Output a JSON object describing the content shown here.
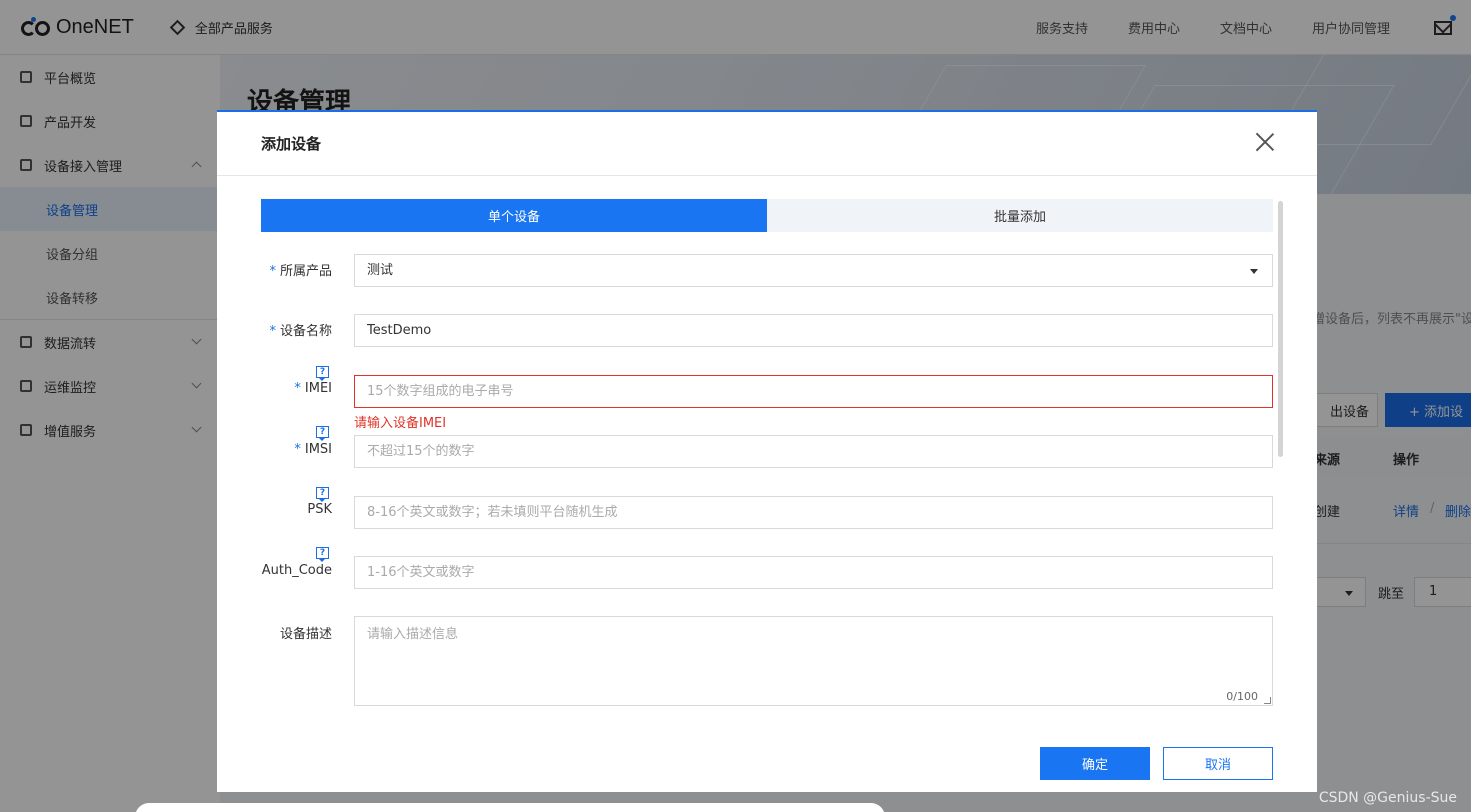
{
  "app": {
    "logo_text": "OneNET",
    "all_products": "全部产品服务",
    "top_nav": [
      "服务支持",
      "费用中心",
      "文档中心",
      "用户协同管理"
    ]
  },
  "sidebar": {
    "items": [
      {
        "label": "平台概览"
      },
      {
        "label": "产品开发"
      },
      {
        "label": "设备接入管理"
      },
      {
        "label": "设备管理"
      },
      {
        "label": "设备分组"
      },
      {
        "label": "设备转移"
      },
      {
        "label": "数据流转"
      },
      {
        "label": "运维监控"
      },
      {
        "label": "增值服务"
      }
    ]
  },
  "background": {
    "page_title": "设备管理",
    "note": "增设备后，列表不再展示\"设",
    "export_button": "出设备",
    "add_button": "+ 添加设",
    "table_headers": [
      "来源",
      "操作"
    ],
    "row": {
      "source": "创建",
      "detail": "详情",
      "sep": "/",
      "delete": "删除"
    },
    "pager_jump_label": "跳至",
    "pager_jump_value": "1"
  },
  "modal": {
    "title": "添加设备",
    "tabs": [
      {
        "label": "单个设备",
        "active": true
      },
      {
        "label": "批量添加",
        "active": false
      }
    ],
    "fields": {
      "product": {
        "label": "所属产品",
        "required": true,
        "value": "测试"
      },
      "device_name": {
        "label": "设备名称",
        "required": true,
        "value": "TestDemo"
      },
      "imei": {
        "label": "IMEI",
        "required": true,
        "placeholder": "15个数字组成的电子串号",
        "error": "请输入设备IMEI"
      },
      "imsi": {
        "label": "IMSI",
        "required": true,
        "placeholder": "不超过15个的数字"
      },
      "psk": {
        "label": "PSK",
        "required": false,
        "placeholder": "8-16个英文或数字；若未填则平台随机生成"
      },
      "auth_code": {
        "label": "Auth_Code",
        "required": false,
        "placeholder": "1-16个英文或数字"
      },
      "description": {
        "label": "设备描述",
        "placeholder": "请输入描述信息",
        "counter": "0/100"
      }
    },
    "help_glyph": "?",
    "required_mark": "*",
    "ok_label": "确定",
    "cancel_label": "取消"
  },
  "watermark": "CSDN @Genius-Sue",
  "colors": {
    "primary": "#1a75f2",
    "error": "#e0342a",
    "overlay": "rgba(0,0,0,0.42)"
  }
}
